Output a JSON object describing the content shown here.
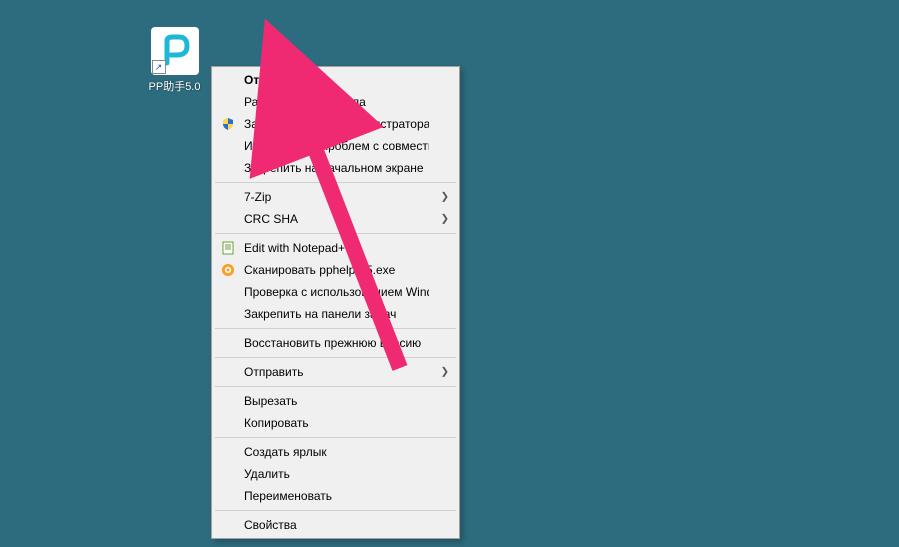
{
  "desktop": {
    "icon_label": "PP助手5.0",
    "p_letter": "P"
  },
  "context_menu": {
    "items": [
      {
        "label": "Открыть",
        "bold": true
      },
      {
        "label": "Расположение файла"
      },
      {
        "label": "Запуск от имени администратора",
        "icon": "shield"
      },
      {
        "label": "Исправление проблем с совместимостью"
      },
      {
        "label": "Закрепить на начальном экране"
      },
      {
        "sep": true
      },
      {
        "label": "7-Zip",
        "submenu": true
      },
      {
        "label": "CRC SHA",
        "submenu": true
      },
      {
        "sep": true
      },
      {
        "label": "Edit with Notepad++",
        "icon": "notepad"
      },
      {
        "label": "Сканировать pphelper5.exe",
        "icon": "avast"
      },
      {
        "label": "Проверка с использованием Windows Defender..."
      },
      {
        "label": "Закрепить на панели задач"
      },
      {
        "sep": true
      },
      {
        "label": "Восстановить прежнюю версию"
      },
      {
        "sep": true
      },
      {
        "label": "Отправить",
        "submenu": true
      },
      {
        "sep": true
      },
      {
        "label": "Вырезать"
      },
      {
        "label": "Копировать"
      },
      {
        "sep": true
      },
      {
        "label": "Создать ярлык"
      },
      {
        "label": "Удалить"
      },
      {
        "label": "Переименовать"
      },
      {
        "sep": true
      },
      {
        "label": "Свойства"
      }
    ]
  },
  "annotation": {
    "color": "#ef2a72"
  }
}
